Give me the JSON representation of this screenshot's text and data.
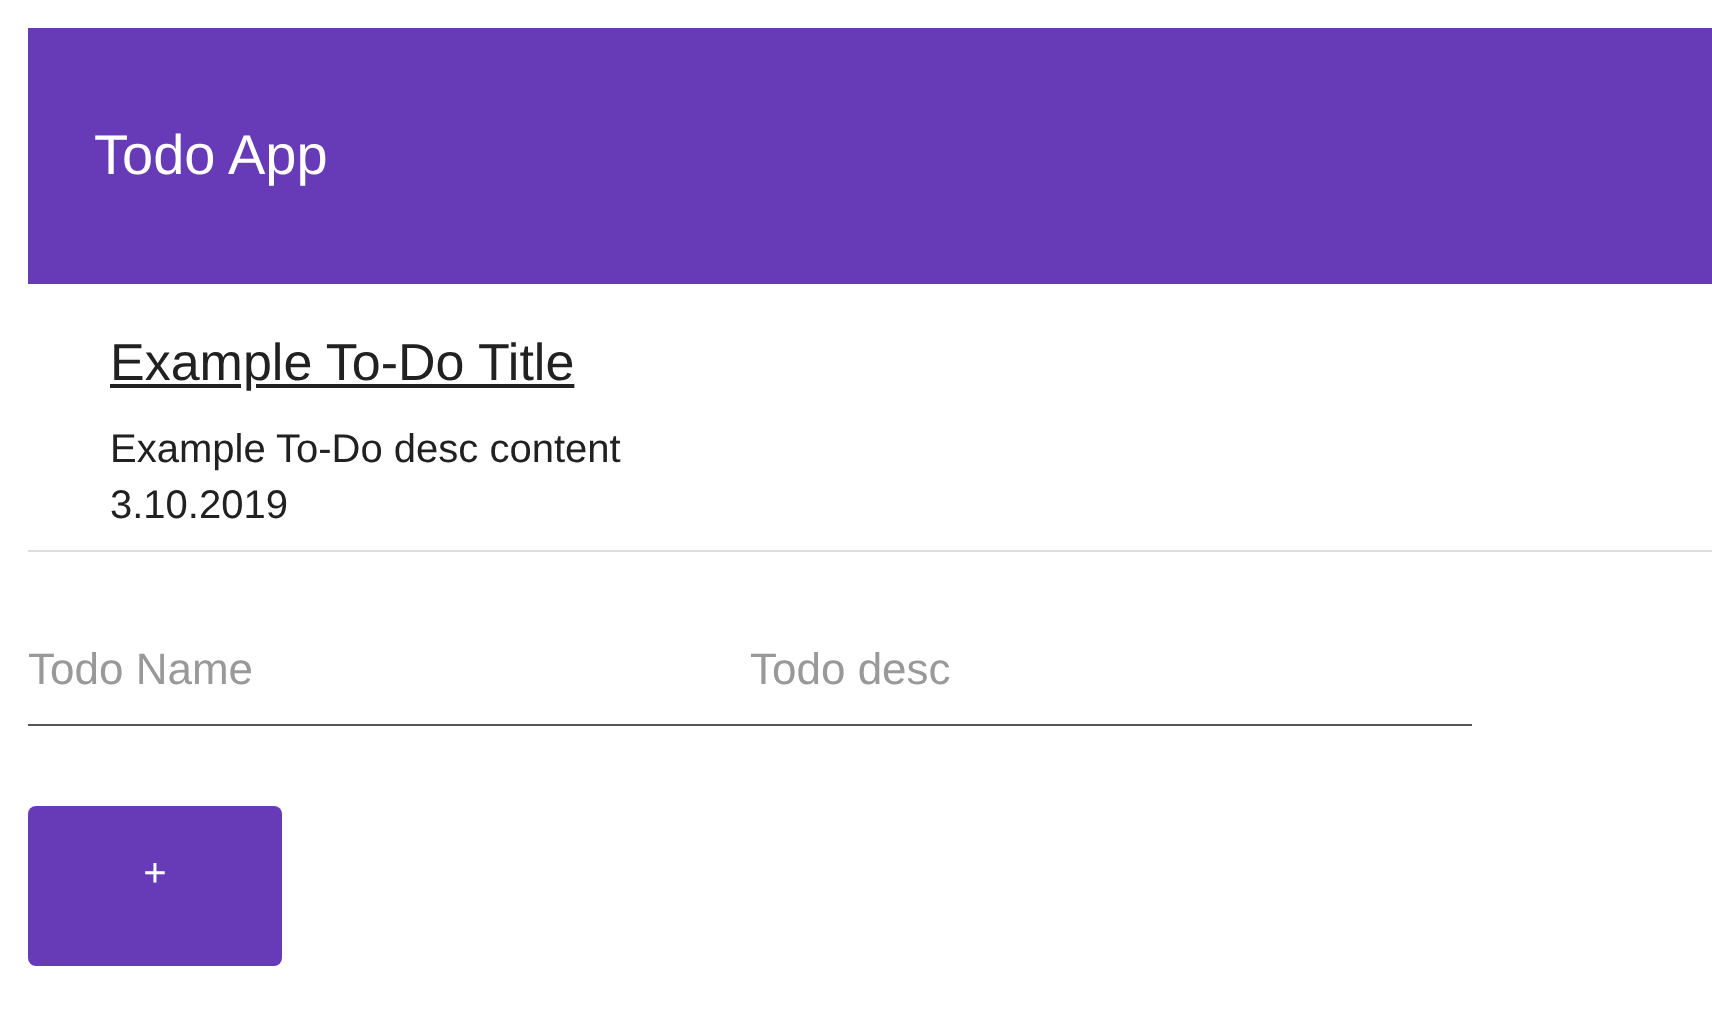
{
  "app_bar": {
    "title": "Todo App"
  },
  "todos": [
    {
      "title": "Example To-Do Title",
      "description": "Example To-Do desc content",
      "date": "3.10.2019"
    }
  ],
  "form": {
    "fields": [
      {
        "placeholder": "Todo Name"
      },
      {
        "placeholder": "Todo desc"
      }
    ],
    "button": "+"
  }
}
